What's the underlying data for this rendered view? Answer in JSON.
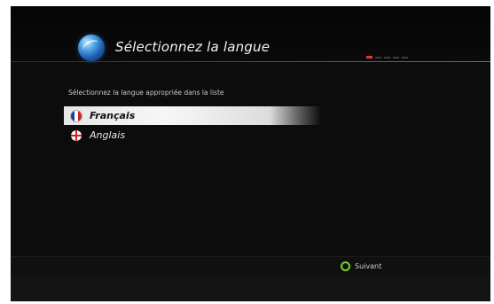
{
  "header": {
    "title": "Sélectionnez la langue",
    "logo_icon": "globe-icon",
    "progress": {
      "current": 1,
      "total": 5,
      "active_color": "#e03a2a"
    }
  },
  "main": {
    "instruction": "Sélectionnez la langue appropriée dans la liste",
    "languages": [
      {
        "label": "Français",
        "icon": "french-flag-icon",
        "selected": true
      },
      {
        "label": "Anglais",
        "icon": "uk-flag-icon",
        "selected": false
      }
    ]
  },
  "footer": {
    "next_label": "Suivant",
    "next_icon": "green-circle-icon",
    "next_color": "#7ed321"
  }
}
